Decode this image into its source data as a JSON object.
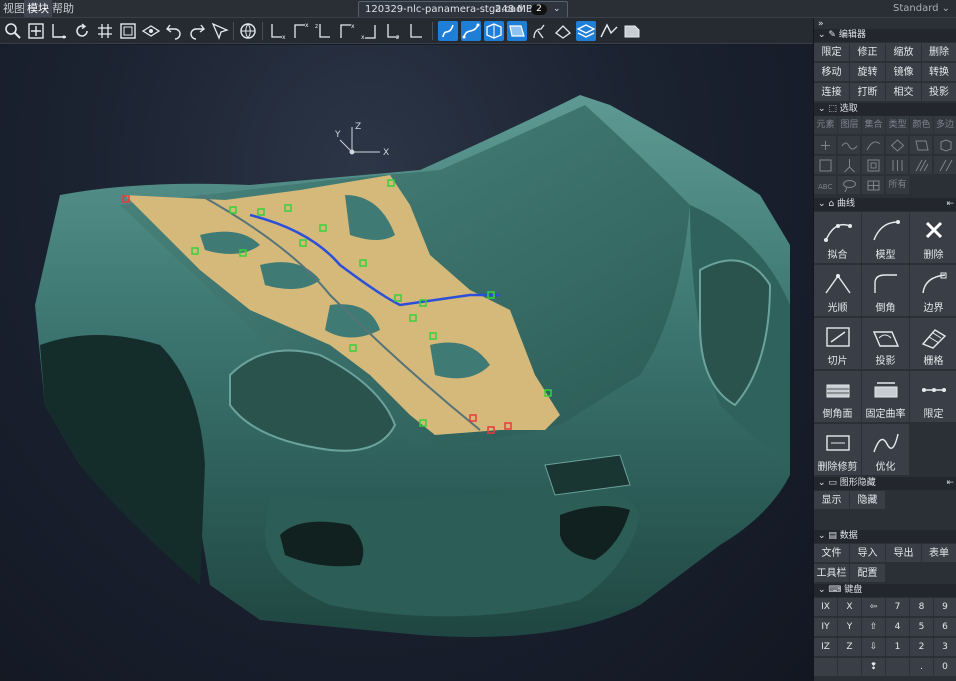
{
  "menubar": {
    "items": [
      "视图",
      "模块",
      "帮助"
    ],
    "active_index": 1
  },
  "file_tab": {
    "name": "120329-nlc-panamera-stga.cad",
    "size": "248 MB",
    "count": "2"
  },
  "workspace": {
    "label": "Standard ⌄"
  },
  "toolbar": {
    "icons": [
      "zoom-icon",
      "zoom-fit-icon",
      "axis-icon",
      "rotate-icon",
      "grid-icon",
      "frame-icon",
      "view-icon",
      "undo-icon",
      "redo-icon",
      "select-icon",
      "globe-icon",
      "axis-x-icon",
      "axis-xy-icon",
      "axis-zx-icon",
      "axis-yx-icon",
      "axis-z-icon",
      "axis-flat-icon",
      "curve-edit-icon",
      "curve-icon",
      "surface-icon",
      "patch-icon",
      "hand-icon",
      "hand-surface-icon",
      "layer-icon",
      "deviation-icon",
      "sheet-icon"
    ]
  },
  "panel": {
    "collapse_glyph": "»",
    "editor": {
      "title": "编辑器",
      "buttons": [
        "限定",
        "修正",
        "缩放",
        "删除",
        "移动",
        "旋转",
        "镜像",
        "转换",
        "连接",
        "打断",
        "相交",
        "投影"
      ]
    },
    "select": {
      "title": "选取",
      "filters": [
        "元素",
        "图层",
        "集合",
        "类型",
        "颜色",
        "多边"
      ],
      "last_label": "所有"
    },
    "curves": {
      "title": "曲线",
      "tools": [
        "拟合",
        "模型",
        "删除",
        "光顺",
        "倒角",
        "边界",
        "切片",
        "投影",
        "栅格",
        "倒角面",
        "固定曲率",
        "限定",
        "删除修剪",
        "优化"
      ]
    },
    "display": {
      "title": "图形隐藏",
      "buttons": [
        "显示",
        "隐藏"
      ]
    },
    "data": {
      "title": "数据",
      "buttons": [
        "文件",
        "导入",
        "导出",
        "表单",
        "工具栏",
        "配置"
      ]
    },
    "keyboard": {
      "title": "键盘",
      "keys": [
        "IX",
        "X",
        "⇦",
        "7",
        "8",
        "9",
        "IY",
        "Y",
        "⇧",
        "4",
        "5",
        "6",
        "IZ",
        "Z",
        "⇩",
        "1",
        "2",
        "3",
        "",
        "",
        "❢",
        "",
        ".",
        "0",
        "-"
      ]
    }
  },
  "viewport": {
    "axis_labels": [
      "Y",
      "Z",
      "X"
    ]
  },
  "colors": {
    "accent": "#1f7fd6",
    "panel_bg": "#2b2f36",
    "car_body": "#3f7a74",
    "surface_patch": "#d8bd7c"
  }
}
